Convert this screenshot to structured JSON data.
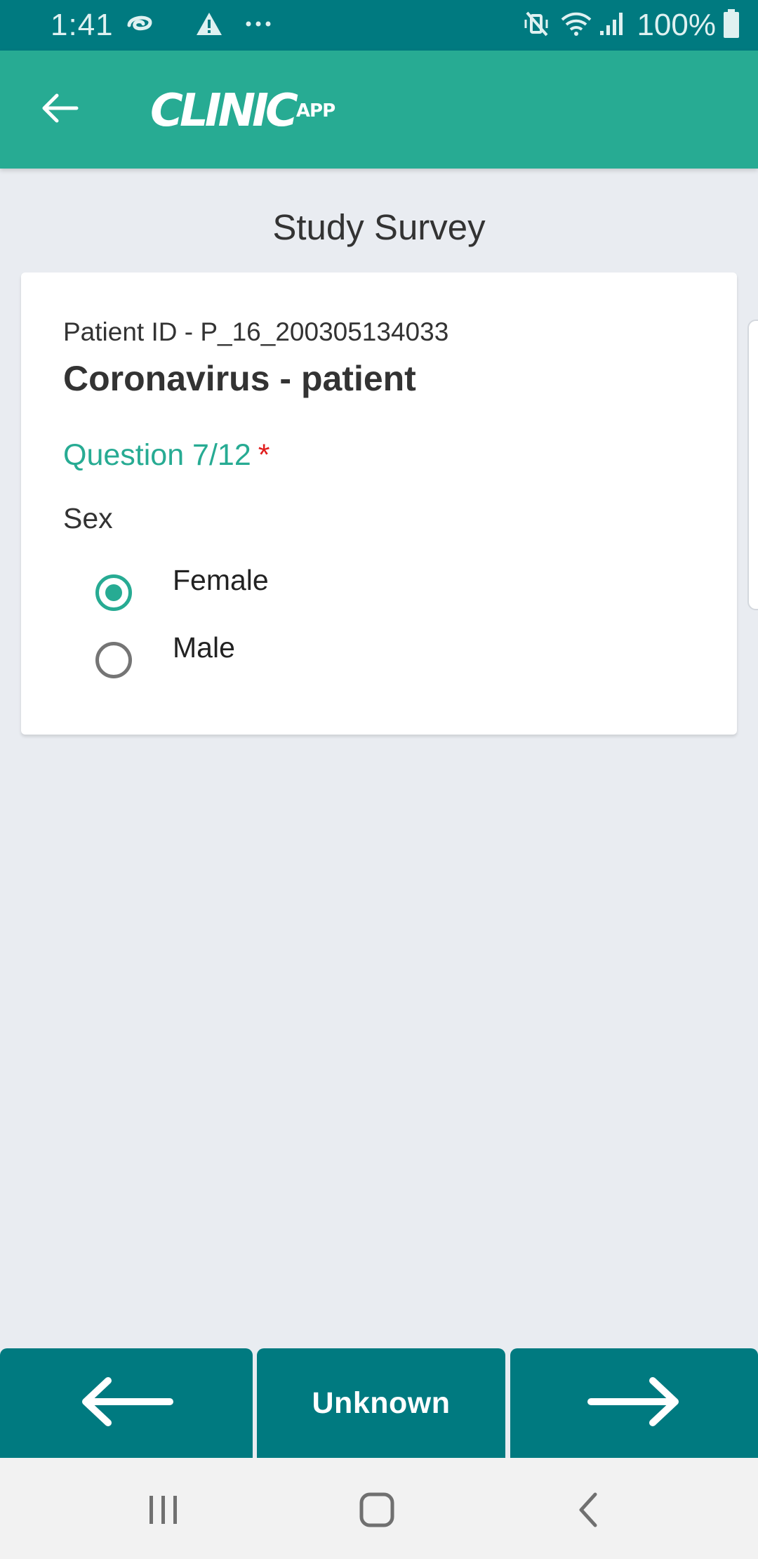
{
  "status_bar": {
    "time": "1:41",
    "battery": "100%",
    "icons": [
      "sync-icon",
      "warning-icon",
      "more-dots-icon",
      "mute-vibrate-icon",
      "wifi-icon",
      "signal-icon",
      "battery-icon"
    ]
  },
  "app_bar": {
    "back_icon": "arrow-left-icon",
    "logo_main": "CLINIC",
    "logo_sub": "APP",
    "brand_color": "#27ab93"
  },
  "page": {
    "title": "Study Survey"
  },
  "survey": {
    "patient_id": "Patient ID - P_16_200305134033",
    "name": "Coronavirus - patient",
    "question_number": "Question 7/12",
    "required_marker": "*",
    "question_text": "Sex",
    "options": [
      {
        "label": "Female",
        "selected": true
      },
      {
        "label": "Male",
        "selected": false
      }
    ]
  },
  "bottom_nav": {
    "prev_icon": "arrow-left-icon",
    "unknown_label": "Unknown",
    "next_icon": "arrow-right-icon",
    "color": "#007a80"
  },
  "system_nav": {
    "buttons": [
      "recents-icon",
      "home-icon",
      "back-icon"
    ]
  }
}
